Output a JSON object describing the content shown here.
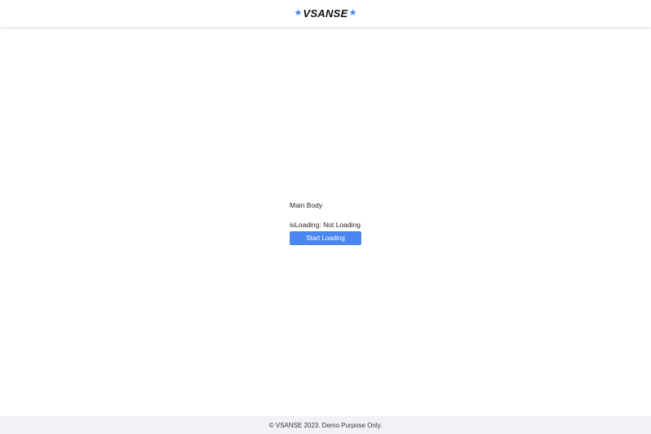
{
  "header": {
    "brand": "VSANSE",
    "star_left": "★",
    "star_right": "★"
  },
  "main": {
    "title": "Main Body",
    "status_label": "isLoading: Not Loading",
    "button_label": "Start Loading"
  },
  "footer": {
    "text": "© VSANSE 2023. Demo Purpose Only."
  },
  "colors": {
    "accent": "#4a86f0",
    "footer_bg": "#f1f2f5"
  }
}
